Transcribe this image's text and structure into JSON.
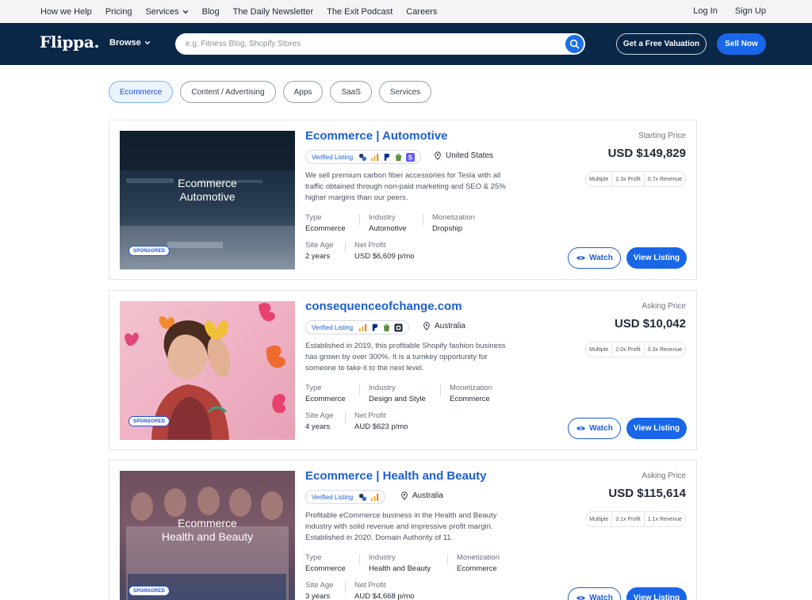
{
  "topbar": {
    "nav": [
      "How we Help",
      "Pricing",
      "Services",
      "Blog",
      "The Daily Newsletter",
      "The Exit Podcast",
      "Careers"
    ],
    "login": "Log In",
    "signup": "Sign Up"
  },
  "header": {
    "logo": "Flippa.",
    "browse": "Browse",
    "search_placeholder": "e.g. Fitness Blog, Shopify Stores",
    "valuation": "Get a Free Valuation",
    "sell": "Sell Now"
  },
  "chips": [
    "Ecommerce",
    "Content / Advertising",
    "Apps",
    "SaaS",
    "Services"
  ],
  "active_chip": "Ecommerce",
  "listings": [
    {
      "title": "Ecommerce | Automotive",
      "thumb_caption": [
        "Ecommerce",
        "Automotive"
      ],
      "sponsored": "SPONSORED",
      "verified": "Verified Listing",
      "location": "United States",
      "description": "We sell premium carbon fiber accessories for Tesla with all traffic obtained through non-paid marketing and SEO & 25% higher margins than our peers.",
      "type_label": "Type",
      "type": "Ecommerce",
      "industry_label": "Industry",
      "industry": "Automotive",
      "monetization_label": "Monetization",
      "monetization": "Dropship",
      "age_label": "Site Age",
      "age": "2 years",
      "profit_label": "Net Profit",
      "profit": "USD $6,609 p/mo",
      "price_label": "Starting Price",
      "price": "USD $149,829",
      "multiple_label": "Multiple",
      "profit_multiple": "2.3x Profit",
      "revenue_multiple": "0.7x Revenue",
      "watch": "Watch",
      "view": "View Listing"
    },
    {
      "title": "consequenceofchange.com",
      "thumb_caption": [],
      "sponsored": "SPONSORED",
      "verified": "Verified Listing",
      "location": "Australia",
      "description": "Established in 2019, this profitable Shopify fashion business has grown by over 300%. It is a turnkey opportunity for someone to take it to the next level.",
      "type_label": "Type",
      "type": "Ecommerce",
      "industry_label": "Industry",
      "industry": "Design and Style",
      "monetization_label": "Monetization",
      "monetization": "Ecommerce",
      "age_label": "Site Age",
      "age": "4 years",
      "profit_label": "Net Profit",
      "profit": "AUD $623 p/mo",
      "price_label": "Asking Price",
      "price": "USD $10,042",
      "multiple_label": "Multiple",
      "profit_multiple": "2.0x Profit",
      "revenue_multiple": "0.3x Revenue",
      "watch": "Watch",
      "view": "View Listing"
    },
    {
      "title": "Ecommerce | Health and Beauty",
      "thumb_caption": [
        "Ecommerce",
        "Health and Beauty"
      ],
      "sponsored": "SPONSORED",
      "verified": "Verified Listing",
      "location": "Australia",
      "description": "Profitable eCommerce business in the Health and Beauty industry with solid revenue and impressive profit margin. Established in 2020. Domain Authority of 11.",
      "type_label": "Type",
      "type": "Ecommerce",
      "industry_label": "Industry",
      "industry": "Health and Beauty",
      "monetization_label": "Monetization",
      "monetization": "Ecommerce",
      "age_label": "Site Age",
      "age": "3 years",
      "profit_label": "Net Profit",
      "profit": "AUD $4,668 p/mo",
      "price_label": "Asking Price",
      "price": "USD $115,614",
      "multiple_label": "Multiple",
      "profit_multiple": "3.1x Profit",
      "revenue_multiple": "1.1x Revenue",
      "watch": "Watch",
      "view": "View Listing"
    }
  ]
}
